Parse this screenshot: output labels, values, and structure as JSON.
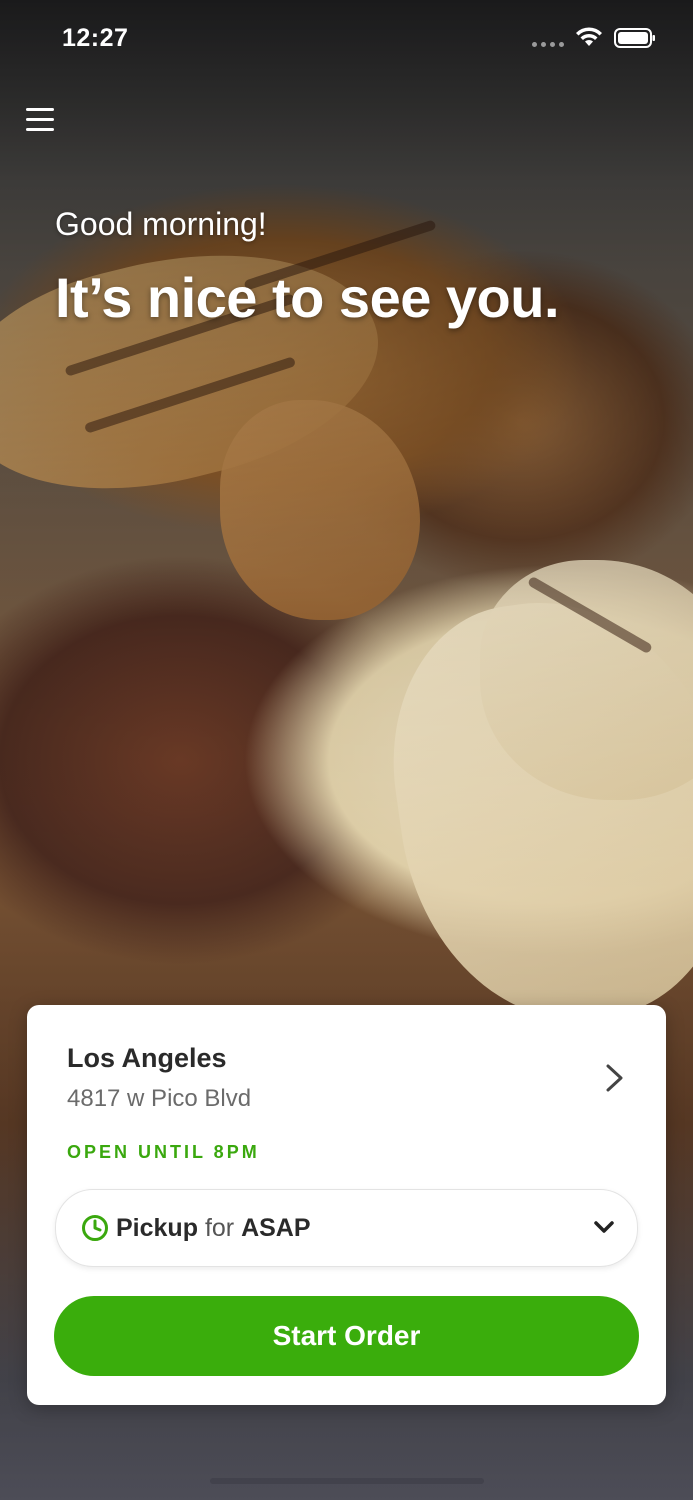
{
  "status_bar": {
    "time": "12:27",
    "signal_icon": "signal-dots-icon",
    "wifi_icon": "wifi-icon",
    "battery_icon": "battery-icon"
  },
  "header": {
    "menu_icon": "hamburger-menu-icon",
    "greeting": "Good morning!",
    "headline": "It’s nice to see you."
  },
  "location_card": {
    "city": "Los Angeles",
    "address": "4817 w Pico Blvd",
    "hours": "OPEN UNTIL 8PM",
    "hours_color": "#3aa80e",
    "chevron_icon": "chevron-right-icon"
  },
  "pickup_selector": {
    "icon": "clock-icon",
    "mode": "Pickup",
    "connector": "for",
    "time": "ASAP",
    "dropdown_icon": "chevron-down-icon"
  },
  "primary_action": {
    "label": "Start Order",
    "color": "#3aad0c"
  }
}
